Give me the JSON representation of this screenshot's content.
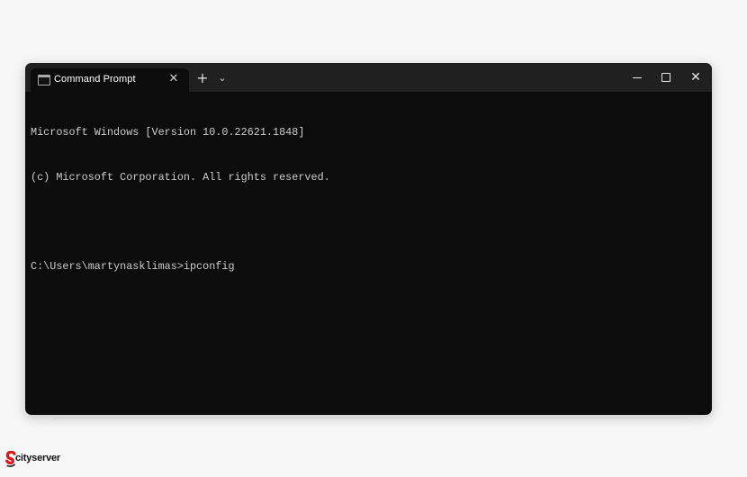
{
  "window": {
    "tab": {
      "title": "Command Prompt",
      "icon": "terminal-icon",
      "close_glyph": "✕"
    },
    "toolbar": {
      "new_tab_glyph": "+",
      "dropdown_glyph": "⌄"
    },
    "controls": {
      "minimize_icon": "minimize-icon",
      "maximize_icon": "maximize-icon",
      "close_glyph": "✕"
    },
    "terminal": {
      "lines": [
        "Microsoft Windows [Version 10.0.22621.1848]",
        "(c) Microsoft Corporation. All rights reserved.",
        "",
        "C:\\Users\\martynasklimas>ipconfig"
      ]
    }
  },
  "branding": {
    "logo_text": "cityserver",
    "logo_icon": "cityserver-logo-icon"
  },
  "colors": {
    "page_background": "#f7f7f7",
    "titlebar": "#202020",
    "terminal_background": "#0c0c0c",
    "terminal_text": "#cccccc",
    "logo_red": "#d71920"
  }
}
